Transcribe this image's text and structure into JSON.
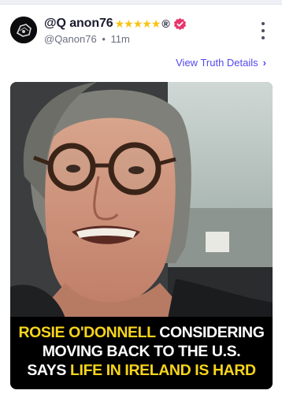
{
  "post": {
    "display_name": "@Q anon76",
    "stars": "★★★★★",
    "registered_mark": "®",
    "handle": "@Qanon76",
    "separator": "•",
    "time_ago": "11m",
    "view_details_label": "View Truth Details",
    "view_details_chevron": "›"
  },
  "icons": {
    "avatar": "avatar-image",
    "verified": "verified-badge-icon",
    "more": "more-vertical-icon",
    "chevron": "chevron-right-icon"
  },
  "colors": {
    "accent": "#5448ee",
    "verified_badge": "#e6366d",
    "stars": "#f7c415",
    "caption_yellow": "#f7d51b"
  },
  "media": {
    "caption": {
      "line1_highlight": "ROSIE O'DONNELL",
      "line1_rest": " CONSIDERING",
      "line2": "MOVING BACK TO THE U.S.",
      "line3_lead": "SAYS ",
      "line3_highlight": "LIFE IN IRELAND IS HARD"
    }
  }
}
